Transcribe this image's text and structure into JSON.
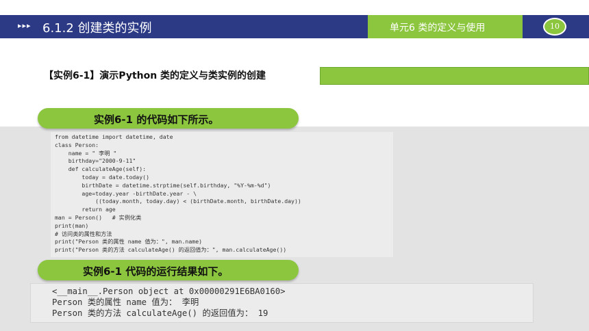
{
  "header": {
    "arrows": "▸▸▸",
    "title": "6.1.2 创建类的实例",
    "unit": "单元6  类的定义与使用",
    "page_number": "10"
  },
  "instance_title": "【实例6-1】演示Python 类的定义与类实例的创建",
  "code_caption": "实例6-1 的代码如下所示。",
  "code_lines": [
    "from datetime import datetime, date",
    "class Person:",
    "    name = \" 李明 \"",
    "    birthday=\"2000-9-11\"",
    "    def calculateAge(self):",
    "        today = date.today()",
    "        birthDate = datetime.strptime(self.birthday, \"%Y-%m-%d\")",
    "        age=today.year -birthDate.year - \\",
    "            ((today.month, today.day) < (birthDate.month, birthDate.day))",
    "        return age",
    "man = Person()   # 实例化类",
    "print(man)",
    "# 访问类的属性和方法",
    "print(\"Person 类的属性 name 值为：\", man.name)",
    "print(\"Person 类的方法 calculateAge() 的返回值为：\", man.calculateAge())"
  ],
  "result_caption": "实例6-1 代码的运行结果如下。",
  "result_lines": [
    "<__main__.Person object at 0x00000291E6BA0160>",
    "Person 类的属性 name 值为： 李明",
    "Person 类的方法 calculateAge() 的返回值为： 19"
  ],
  "colors": {
    "header_bg": "#2c3a86",
    "accent_green": "#8cc63f",
    "panel_gray": "#e3e3e3"
  }
}
